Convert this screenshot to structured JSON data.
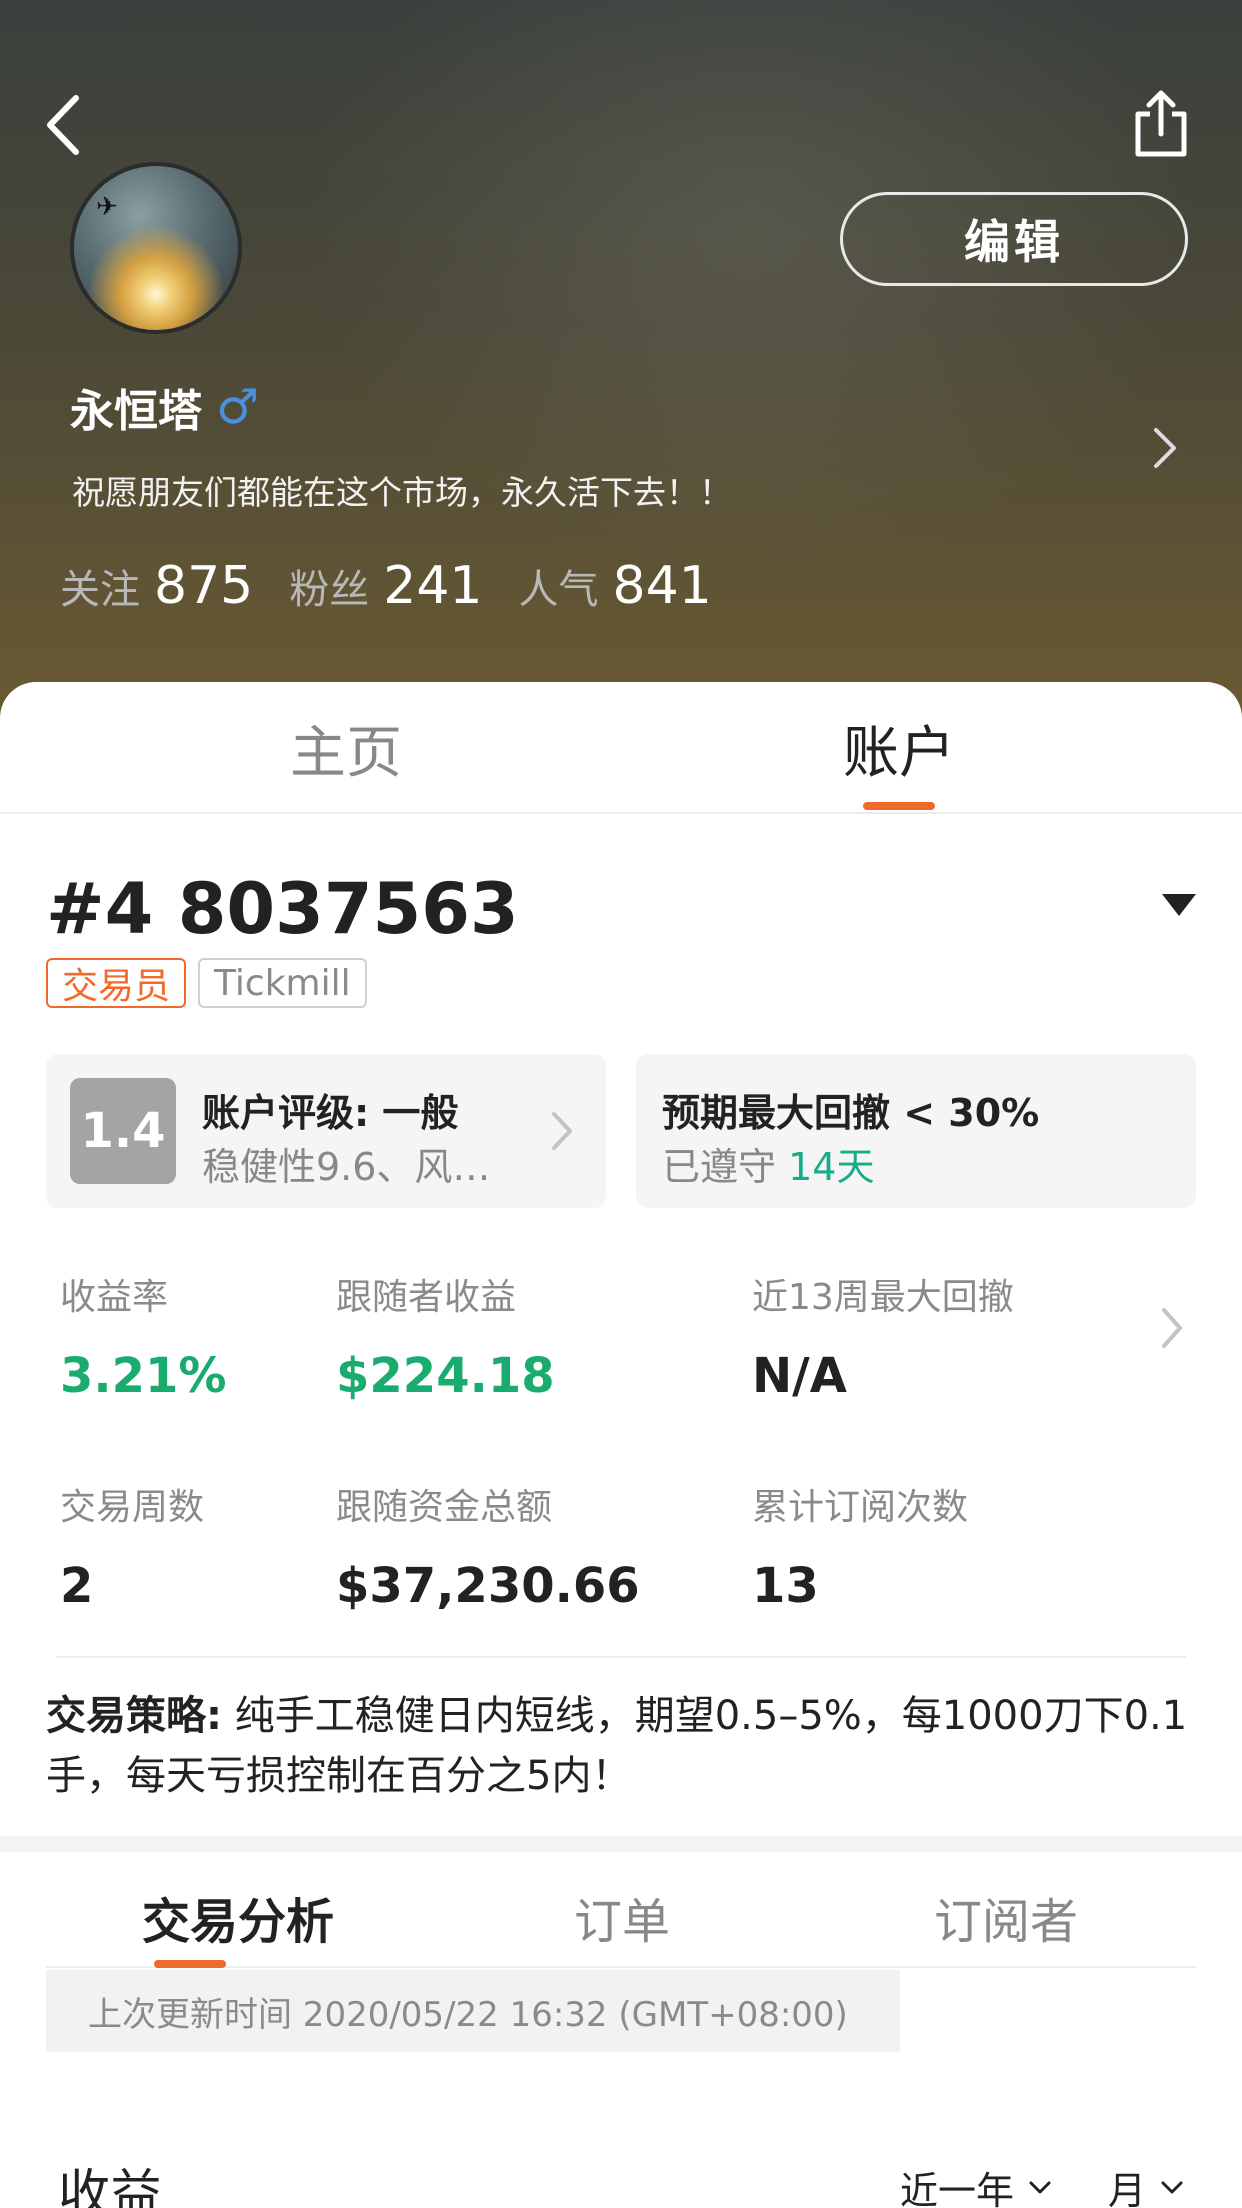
{
  "profile": {
    "username": "永恒塔",
    "gender_symbol": "♂",
    "bio": "祝愿朋友们都能在这个市场，永久活下去！！",
    "edit_label": "编辑",
    "stats": [
      {
        "label": "关注",
        "value": "875"
      },
      {
        "label": "粉丝",
        "value": "241"
      },
      {
        "label": "人气",
        "value": "841"
      }
    ]
  },
  "top_tabs": [
    {
      "label": "主页",
      "active": false
    },
    {
      "label": "账户",
      "active": true
    }
  ],
  "account": {
    "number": "#4 8037563",
    "badges": [
      "交易员",
      "Tickmill"
    ],
    "rating": {
      "score": "1.4",
      "title": "账户评级: 一般",
      "detail": "稳健性9.6、风…"
    },
    "drawdown": {
      "title": "预期最大回撤 < 30%",
      "kept_prefix": "已遵守",
      "kept_days": "14天"
    },
    "metrics": [
      {
        "label": "收益率",
        "value": "3.21%",
        "tone": "green"
      },
      {
        "label": "跟随者收益",
        "value": "$224.18",
        "tone": "green"
      },
      {
        "label": "近13周最大回撤",
        "value": "N/A",
        "tone": "dark"
      },
      {
        "label": "交易周数",
        "value": "2",
        "tone": "dark"
      },
      {
        "label": "跟随资金总额",
        "value": "$37,230.66",
        "tone": "dark"
      },
      {
        "label": "累计订阅次数",
        "value": "13",
        "tone": "dark"
      }
    ],
    "strategy_label": "交易策略:",
    "strategy_text": " 纯手工稳健日内短线，期望0.5–5%，每1000刀下0.1手，每天亏损控制在百分之5内！"
  },
  "sub_tabs": [
    {
      "label": "交易分析",
      "active": true
    },
    {
      "label": "订单",
      "active": false
    },
    {
      "label": "订阅者",
      "active": false
    }
  ],
  "update_text": "上次更新时间 2020/05/22 16:32 (GMT+08:00)",
  "earnings": {
    "title": "收益",
    "period": "近一年",
    "unit": "月"
  },
  "colors": {
    "accent": "#f06a2c",
    "positive": "#1aab6e",
    "gender": "#4a90e2"
  },
  "icons": [
    "back-arrow-icon",
    "share-icon",
    "chevron-right-icon",
    "caret-down-icon",
    "male-icon"
  ]
}
